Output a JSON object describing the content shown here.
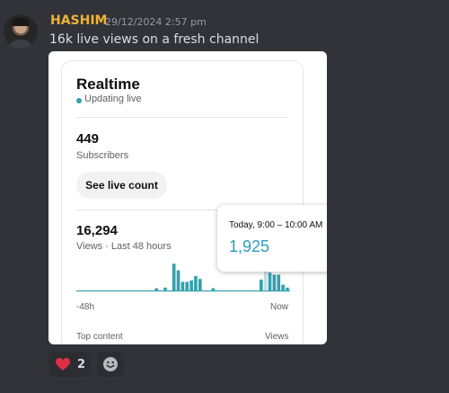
{
  "message": {
    "username": "HASHIM",
    "timestamp": "29/12/2024 2:57 pm",
    "content": "16k live views on a fresh channel",
    "username_color": "#f0b232"
  },
  "realtime_card": {
    "title": "Realtime",
    "status": "Updating live",
    "subscribers": {
      "value": "449",
      "label": "Subscribers"
    },
    "button_label": "See live count",
    "views": {
      "value": "16,294",
      "label": "Views · Last 48 hours"
    },
    "chart_x_start": "-48h",
    "chart_x_end": "Now",
    "footer_left": "Top content",
    "footer_right": "Views",
    "accent_color": "#35a0b0"
  },
  "tooltip": {
    "time": "Today, 9:00 – 10:00 AM",
    "value": "1,925"
  },
  "reactions": [
    {
      "icon": "heart-icon",
      "count": "2"
    },
    {
      "icon": "add-emoji-icon"
    }
  ],
  "chart_data": {
    "type": "bar",
    "xlabel": "",
    "ylabel": "",
    "x_range": [
      "-48h",
      "Now"
    ],
    "values": [
      0,
      0,
      0,
      0,
      0,
      0,
      0,
      0,
      0,
      0,
      0,
      0,
      0,
      0,
      0,
      0,
      0,
      0,
      0.08,
      0,
      0.1,
      0,
      0.93,
      0.7,
      0.3,
      0.3,
      0.35,
      0.5,
      0.4,
      0,
      0,
      0.08,
      0,
      0,
      0,
      0,
      0,
      0,
      0,
      0,
      0,
      0,
      0.38,
      0.85,
      0.62,
      0.55,
      0.55,
      0.2,
      0.1
    ],
    "highlight_index": 43,
    "highlight_color": "#c8dde2"
  }
}
